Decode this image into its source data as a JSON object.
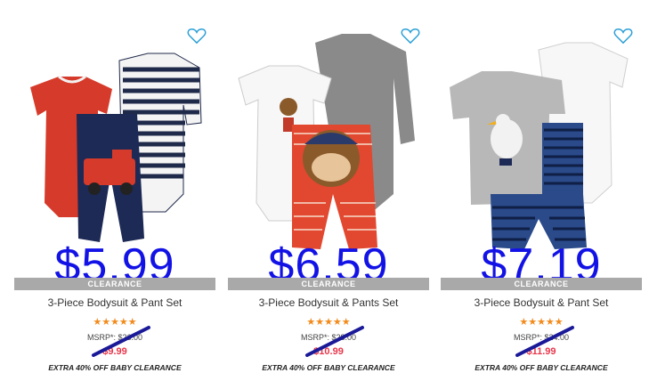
{
  "products": [
    {
      "overlay_price": "$5.99",
      "banner": "CLEARANCE",
      "title": "3-Piece Bodysuit & Pant Set",
      "rating": 5,
      "stars": "★★★★★",
      "msrp": "MSRP*: $26.00",
      "sale_price": "$9.99",
      "promo": "EXTRA 40% OFF BABY CLEARANCE"
    },
    {
      "overlay_price": "$6.59",
      "banner": "CLEARANCE",
      "title": "3-Piece Bodysuit & Pants Set",
      "rating": 5,
      "stars": "★★★★★",
      "msrp": "MSRP*: $28.00",
      "sale_price": "$10.99",
      "promo": "EXTRA 40% OFF BABY CLEARANCE"
    },
    {
      "overlay_price": "$7.19",
      "banner": "CLEARANCE",
      "title": "3-Piece Bodysuit & Pant Set",
      "rating": 5,
      "stars": "★★★★★",
      "msrp": "MSRP*: $24.00",
      "sale_price": "$11.99",
      "promo": "EXTRA 40% OFF BABY CLEARANCE"
    }
  ],
  "colors": {
    "overlay_price": "#1212e6",
    "sale_price": "#e8364a",
    "stars": "#f28b1c",
    "banner": "#a9a9a9",
    "heart": "#2a9fd6"
  },
  "icons": {
    "favorite": "heart-outline-icon",
    "strike": "strikethrough-slash"
  }
}
